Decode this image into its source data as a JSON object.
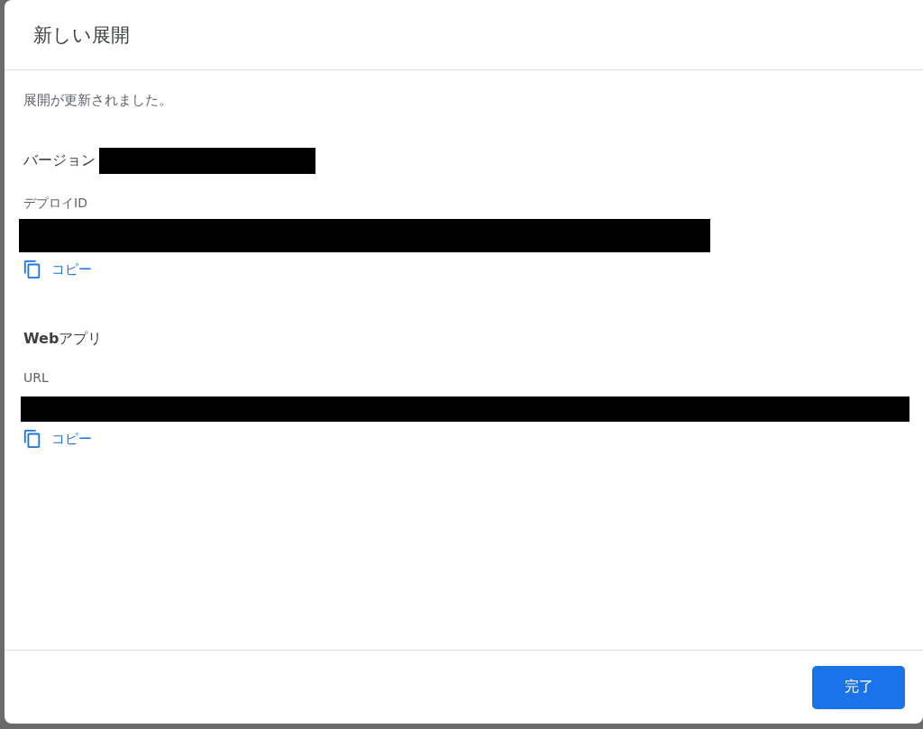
{
  "dialog": {
    "title": "新しい展開"
  },
  "message": "展開が更新されました。",
  "version": {
    "label": "バージョン"
  },
  "deployment_id": {
    "label": "デプロイID",
    "copy": "コピー"
  },
  "web_app": {
    "heading": "**Web**アプリ",
    "label": "URL",
    "copy": "コピー"
  },
  "buttons": [
    "完了"
  ]
}
